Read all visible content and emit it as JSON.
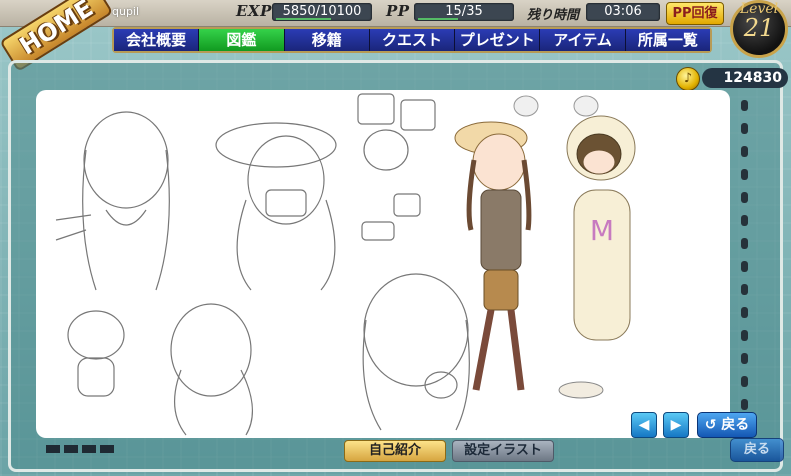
{
  "home": {
    "label": "HOME"
  },
  "user": {
    "name": "qupil"
  },
  "stats": {
    "exp_label": "EXP",
    "exp_value": "5850/10100",
    "pp_label": "PP",
    "pp_value": "15/35",
    "time_label": "残り時間",
    "time_value": "03:06",
    "pp_recover": "PP回復"
  },
  "level": {
    "label": "Level",
    "value": "21"
  },
  "nav": {
    "items": [
      {
        "label": "会社概要"
      },
      {
        "label": "図鑑"
      },
      {
        "label": "移籍"
      },
      {
        "label": "クエスト"
      },
      {
        "label": "プレゼント"
      },
      {
        "label": "アイテム"
      },
      {
        "label": "所属一覧"
      }
    ],
    "active_index": 1
  },
  "currency": {
    "value": "124830",
    "icon": "coin-note-icon"
  },
  "viewer": {
    "prev_icon": "◀",
    "next_icon": "▶",
    "back_label": "戻る",
    "back_icon": "↺"
  },
  "bottom_tabs": {
    "intro": "自己紹介",
    "illust": "設定イラスト",
    "back_behind": "戻る"
  },
  "colors": {
    "nav_active": "#1fb52e",
    "nav_default": "#2233a0",
    "accent_gold": "#c9a34a"
  }
}
